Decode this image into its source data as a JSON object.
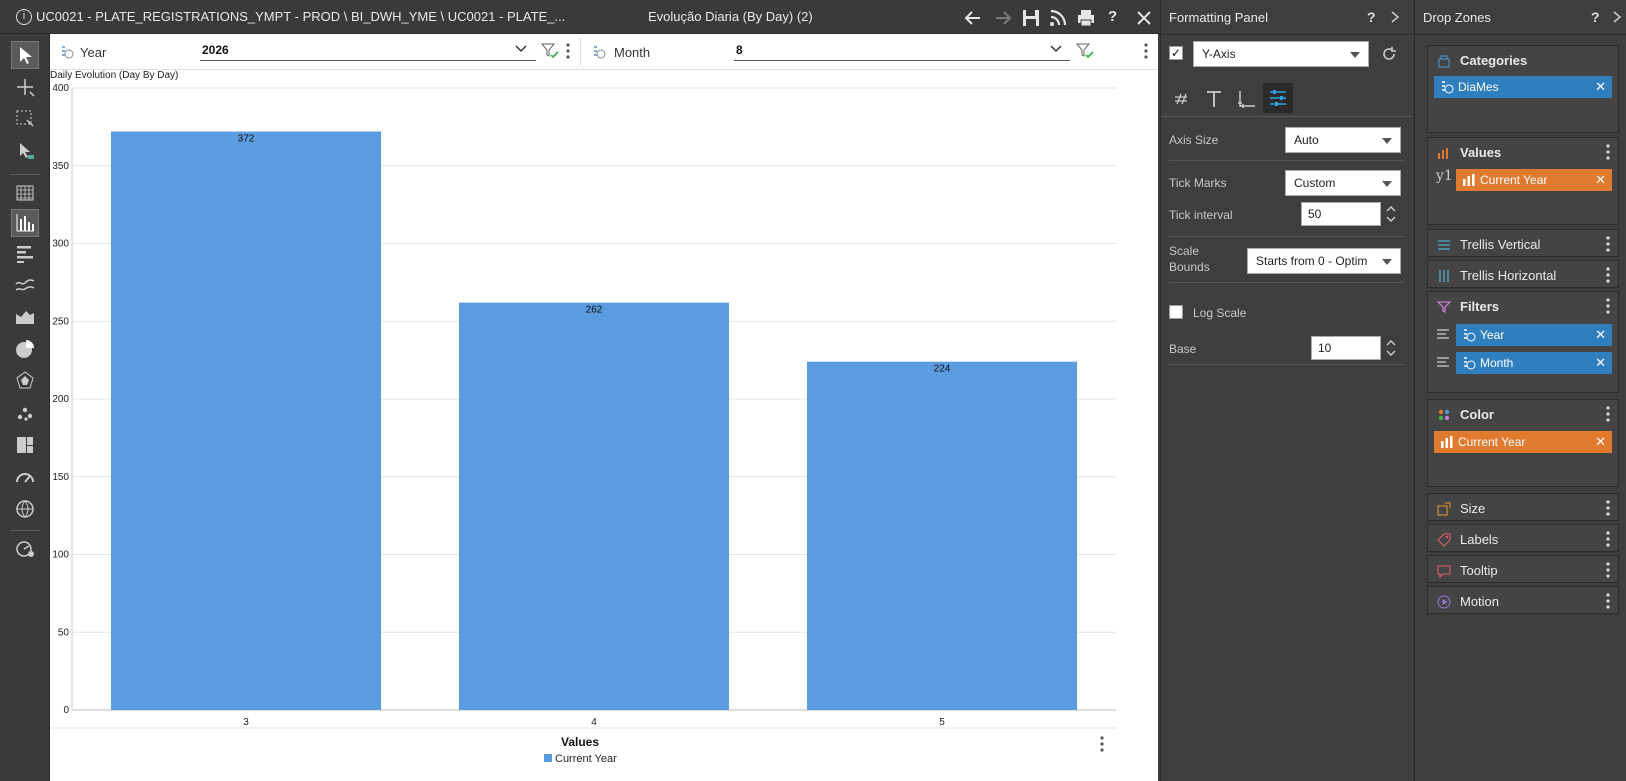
{
  "titlebar": {
    "path": "UC0021 - PLATE_REGISTRATIONS_YMPT - PROD \\ BI_DWH_YME \\ UC0021 - PLATE_...",
    "report_title": "Evolução Diaria (By Day) (2)",
    "help": "?"
  },
  "filters": [
    {
      "label": "Year",
      "value": "2026"
    },
    {
      "label": "Month",
      "value": "8"
    }
  ],
  "chart_data": {
    "type": "bar",
    "title": "Daily Evolution (Day By Day)",
    "categories": [
      "3",
      "4",
      "5"
    ],
    "series": [
      {
        "name": "Current Year",
        "values": [
          372,
          262,
          224
        ],
        "color": "#5b9bdf"
      }
    ],
    "ylim": [
      0,
      400
    ],
    "yticks": [
      0,
      50,
      100,
      150,
      200,
      250,
      300,
      350,
      400
    ],
    "legend_title": "Values",
    "legend_position": "bottom-center",
    "grid": true
  },
  "formatting_panel": {
    "title": "Formatting Panel",
    "help": "?",
    "section_select": "Y-Axis",
    "axis_size_label": "Axis Size",
    "axis_size_value": "Auto",
    "tick_marks_label": "Tick Marks",
    "tick_marks_value": "Custom",
    "tick_interval_label": "Tick interval",
    "tick_interval_value": "50",
    "scale_bounds_label_1": "Scale",
    "scale_bounds_label_2": "Bounds",
    "scale_bounds_value": "Starts from 0 - Optim",
    "log_scale_label": "Log Scale",
    "base_label": "Base",
    "base_value": "10"
  },
  "drop_zones": {
    "title": "Drop Zones",
    "help": "?",
    "categories": {
      "title": "Categories",
      "chips": [
        "DiaMes"
      ]
    },
    "values": {
      "title": "Values",
      "axis": "y1",
      "chips": [
        "Current Year"
      ]
    },
    "trellis_vertical": "Trellis Vertical",
    "trellis_horizontal": "Trellis Horizontal",
    "filters": {
      "title": "Filters",
      "chips": [
        "Year",
        "Month"
      ]
    },
    "color": {
      "title": "Color",
      "chips": [
        "Current Year"
      ]
    },
    "size": "Size",
    "labels": "Labels",
    "tooltip": "Tooltip",
    "motion": "Motion"
  },
  "colors": {
    "accent_blue": "#2f7fbf",
    "accent_orange": "#e07a2e",
    "bar": "#5b9bdf"
  }
}
